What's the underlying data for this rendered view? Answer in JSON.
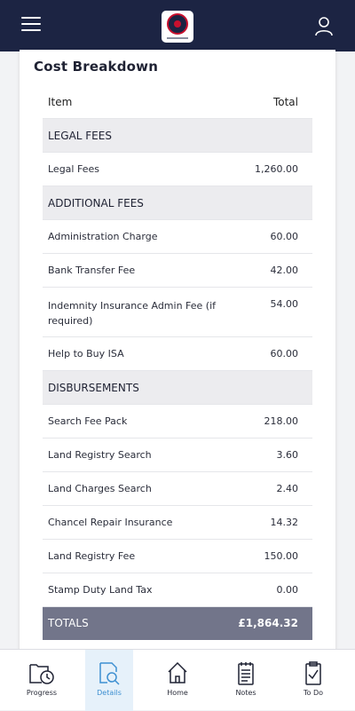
{
  "header": {
    "menu_icon": "hamburger-icon",
    "logo_icon": "brand-logo",
    "user_icon": "user-icon"
  },
  "card": {
    "title": "Cost Breakdown",
    "columns": {
      "item": "Item",
      "total": "Total"
    },
    "sections": {
      "legal": {
        "label": "LEGAL FEES",
        "rows": [
          {
            "item": "Legal Fees",
            "total": "1,260.00"
          }
        ]
      },
      "additional": {
        "label": "ADDITIONAL FEES",
        "rows": [
          {
            "item": "Administration Charge",
            "total": "60.00"
          },
          {
            "item": "Bank Transfer Fee",
            "total": "42.00"
          },
          {
            "item": "Indemnity Insurance Admin Fee (if required)",
            "total": "54.00"
          },
          {
            "item": "Help to Buy ISA",
            "total": "60.00"
          }
        ]
      },
      "disbursements": {
        "label": "DISBURSEMENTS",
        "rows": [
          {
            "item": "Search Fee Pack",
            "total": "218.00"
          },
          {
            "item": "Land Registry Search",
            "total": "3.60"
          },
          {
            "item": "Land Charges Search",
            "total": "2.40"
          },
          {
            "item": "Chancel Repair Insurance",
            "total": "14.32"
          },
          {
            "item": "Land Registry Fee",
            "total": "150.00"
          },
          {
            "item": "Stamp Duty Land Tax",
            "total": "0.00"
          }
        ]
      }
    },
    "totals": {
      "label": "TOTALS",
      "value": "£1,864.32"
    }
  },
  "nav": [
    {
      "label": "Progress",
      "icon": "progress-clock-icon",
      "active": false
    },
    {
      "label": "Details",
      "icon": "details-search-icon",
      "active": true
    },
    {
      "label": "Home",
      "icon": "home-icon",
      "active": false
    },
    {
      "label": "Notes",
      "icon": "notes-icon",
      "active": false
    },
    {
      "label": "To Do",
      "icon": "todo-checklist-icon",
      "active": false
    }
  ],
  "colors": {
    "header_bg": "#1c2443",
    "totals_bg": "#72758a",
    "section_bg": "#ececef",
    "active_nav_bg": "#e6f1fa",
    "active_nav_text": "#3d8fd1"
  }
}
